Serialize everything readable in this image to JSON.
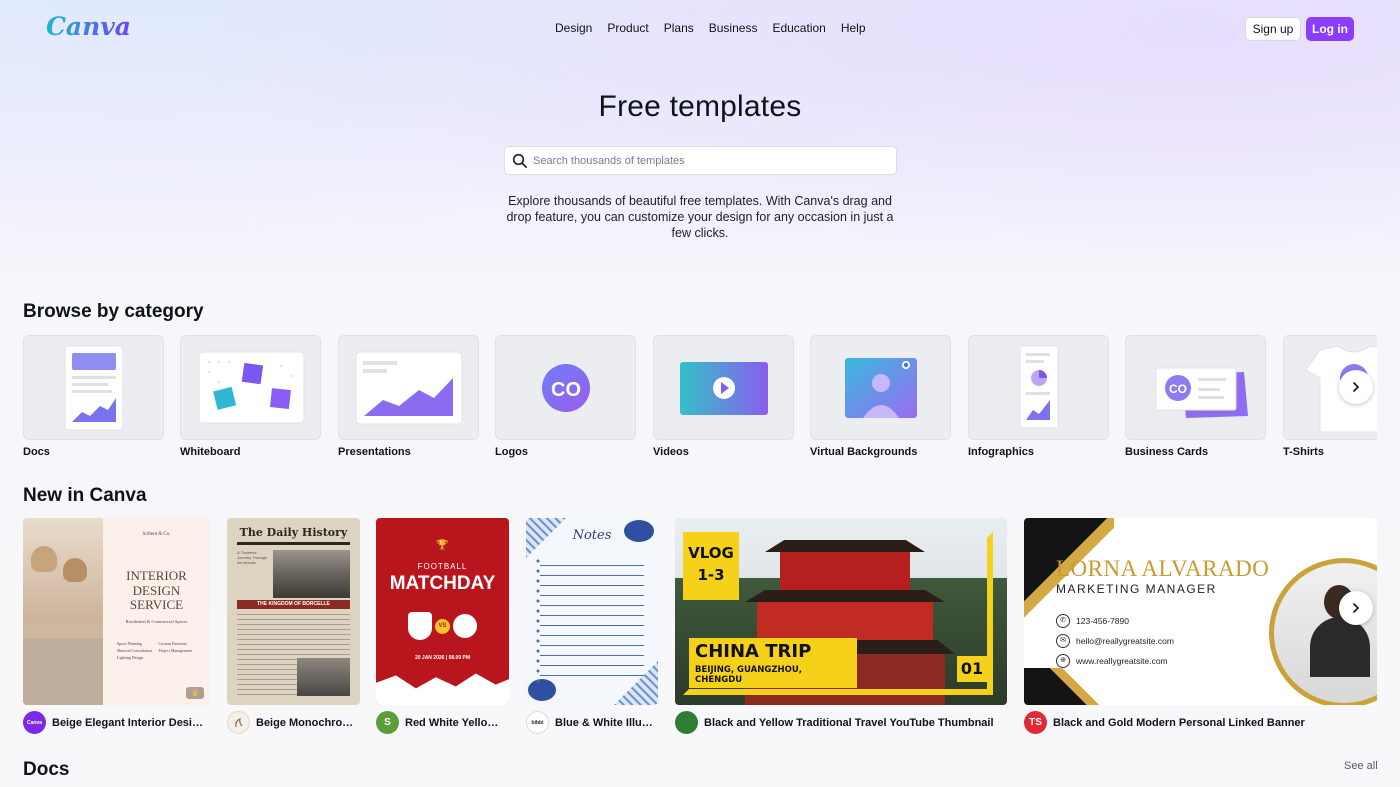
{
  "app": {
    "logo": "Canva"
  },
  "header": {
    "nav": [
      "Design",
      "Product",
      "Plans",
      "Business",
      "Education",
      "Help"
    ],
    "signup_label": "Sign up",
    "login_label": "Log in",
    "accent": "#8b3dff"
  },
  "hero": {
    "title": "Free templates",
    "search_placeholder": "Search thousands of templates",
    "description": "Explore thousands of beautiful free templates. With Canva's drag and drop feature, you can customize your design for any occasion in just a few clicks."
  },
  "browse": {
    "title": "Browse by category",
    "categories": [
      {
        "label": "Docs",
        "icon": "docs-icon"
      },
      {
        "label": "Whiteboard",
        "icon": "whiteboard-icon"
      },
      {
        "label": "Presentations",
        "icon": "presentation-icon"
      },
      {
        "label": "Logos",
        "icon": "logo-icon",
        "logo_text": "CO"
      },
      {
        "label": "Videos",
        "icon": "video-icon"
      },
      {
        "label": "Virtual Backgrounds",
        "icon": "virtual-background-icon"
      },
      {
        "label": "Infographics",
        "icon": "infographic-icon"
      },
      {
        "label": "Business Cards",
        "icon": "business-card-icon",
        "logo_text": "CO"
      },
      {
        "label": "T-Shirts",
        "icon": "tshirt-icon"
      }
    ]
  },
  "new_in_canva": {
    "title": "New in Canva",
    "cards": [
      {
        "title": "Beige Elegant Interior Design ...",
        "avatar_text": "Canva",
        "thumb": {
          "brand": "Softent & Co.",
          "heading": "INTERIOR DESIGN SERVICE",
          "sub": "Residential & Commercial Spaces",
          "services": [
            "Space Planning",
            "Material Consultation",
            "Lighting Design",
            "Custom Furniture",
            "Project Management"
          ]
        }
      },
      {
        "title": "Beige Monochrom...",
        "avatar_text": "",
        "thumb": {
          "heading": "The Daily History",
          "banner": "THE KINGDOM OF BORCELLE"
        }
      },
      {
        "title": "Red White Yellow ...",
        "avatar_text": "S",
        "thumb": {
          "top": "FOOTBALL",
          "heading": "MATCHDAY",
          "vs": "VS",
          "date": "20 JAN 2026 | 08.00 PM"
        }
      },
      {
        "title": "Blue & White Illust...",
        "avatar_text": "bibbi",
        "thumb": {
          "heading": "Notes"
        }
      },
      {
        "title": "Black and Yellow Traditional Travel YouTube Thumbnail",
        "avatar_text": "",
        "thumb": {
          "vlog": "VLOG",
          "episode": "1-3",
          "heading": "CHINA TRIP",
          "places": "BEIJING, GUANGZHOU, CHENGDU",
          "number": "01"
        }
      },
      {
        "title": "Black and Gold Modern Personal Linked Banner",
        "avatar_text": "TS",
        "thumb": {
          "name": "LORNA ALVARADO",
          "role": "MARKETING MANAGER",
          "phone": "123-456-7890",
          "email": "hello@reallygreatsite.com",
          "web": "www.reallygreatsite.com"
        }
      }
    ]
  },
  "docs": {
    "title": "Docs",
    "see_all": "See all"
  }
}
